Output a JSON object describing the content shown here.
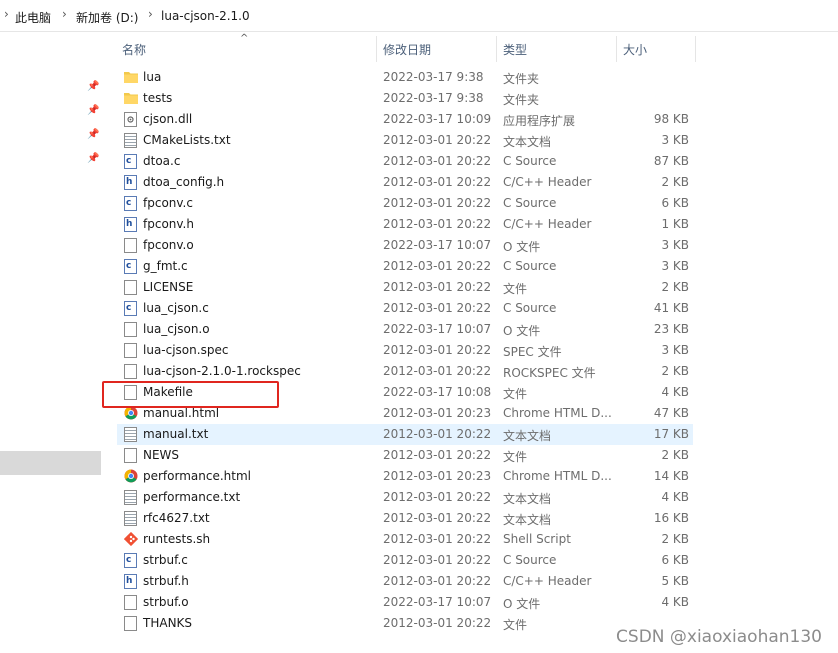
{
  "breadcrumb": [
    "此电脑",
    "新加卷 (D:)",
    "lua-cjson-2.1.0"
  ],
  "columns": {
    "name": "名称",
    "modified": "修改日期",
    "type": "类型",
    "size": "大小"
  },
  "files": [
    {
      "name": "lua",
      "date": "2022-03-17 9:38",
      "type": "文件夹",
      "size": "",
      "icon": "folder-icon"
    },
    {
      "name": "tests",
      "date": "2022-03-17 9:38",
      "type": "文件夹",
      "size": "",
      "icon": "folder-icon"
    },
    {
      "name": "cjson.dll",
      "date": "2022-03-17 10:09",
      "type": "应用程序扩展",
      "size": "98 KB",
      "icon": "dll-icon"
    },
    {
      "name": "CMakeLists.txt",
      "date": "2012-03-01 20:22",
      "type": "文本文档",
      "size": "3 KB",
      "icon": "text-file-icon"
    },
    {
      "name": "dtoa.c",
      "date": "2012-03-01 20:22",
      "type": "C Source",
      "size": "87 KB",
      "icon": "c-file-icon"
    },
    {
      "name": "dtoa_config.h",
      "date": "2012-03-01 20:22",
      "type": "C/C++ Header",
      "size": "2 KB",
      "icon": "h-file-icon"
    },
    {
      "name": "fpconv.c",
      "date": "2012-03-01 20:22",
      "type": "C Source",
      "size": "6 KB",
      "icon": "c-file-icon"
    },
    {
      "name": "fpconv.h",
      "date": "2012-03-01 20:22",
      "type": "C/C++ Header",
      "size": "1 KB",
      "icon": "h-file-icon"
    },
    {
      "name": "fpconv.o",
      "date": "2022-03-17 10:07",
      "type": "O 文件",
      "size": "3 KB",
      "icon": "blank-file-icon"
    },
    {
      "name": "g_fmt.c",
      "date": "2012-03-01 20:22",
      "type": "C Source",
      "size": "3 KB",
      "icon": "c-file-icon"
    },
    {
      "name": "LICENSE",
      "date": "2012-03-01 20:22",
      "type": "文件",
      "size": "2 KB",
      "icon": "blank-file-icon"
    },
    {
      "name": "lua_cjson.c",
      "date": "2012-03-01 20:22",
      "type": "C Source",
      "size": "41 KB",
      "icon": "c-file-icon"
    },
    {
      "name": "lua_cjson.o",
      "date": "2022-03-17 10:07",
      "type": "O 文件",
      "size": "23 KB",
      "icon": "blank-file-icon"
    },
    {
      "name": "lua-cjson.spec",
      "date": "2012-03-01 20:22",
      "type": "SPEC 文件",
      "size": "3 KB",
      "icon": "blank-file-icon"
    },
    {
      "name": "lua-cjson-2.1.0-1.rockspec",
      "date": "2012-03-01 20:22",
      "type": "ROCKSPEC 文件",
      "size": "2 KB",
      "icon": "blank-file-icon"
    },
    {
      "name": "Makefile",
      "date": "2022-03-17 10:08",
      "type": "文件",
      "size": "4 KB",
      "icon": "blank-file-icon"
    },
    {
      "name": "manual.html",
      "date": "2012-03-01 20:23",
      "type": "Chrome HTML D...",
      "size": "47 KB",
      "icon": "chrome-icon"
    },
    {
      "name": "manual.txt",
      "date": "2012-03-01 20:22",
      "type": "文本文档",
      "size": "17 KB",
      "icon": "text-file-icon",
      "selected": true
    },
    {
      "name": "NEWS",
      "date": "2012-03-01 20:22",
      "type": "文件",
      "size": "2 KB",
      "icon": "blank-file-icon"
    },
    {
      "name": "performance.html",
      "date": "2012-03-01 20:23",
      "type": "Chrome HTML D...",
      "size": "14 KB",
      "icon": "chrome-icon"
    },
    {
      "name": "performance.txt",
      "date": "2012-03-01 20:22",
      "type": "文本文档",
      "size": "4 KB",
      "icon": "text-file-icon"
    },
    {
      "name": "rfc4627.txt",
      "date": "2012-03-01 20:22",
      "type": "文本文档",
      "size": "16 KB",
      "icon": "text-file-icon"
    },
    {
      "name": "runtests.sh",
      "date": "2012-03-01 20:22",
      "type": "Shell Script",
      "size": "2 KB",
      "icon": "git-shell-icon"
    },
    {
      "name": "strbuf.c",
      "date": "2012-03-01 20:22",
      "type": "C Source",
      "size": "6 KB",
      "icon": "c-file-icon"
    },
    {
      "name": "strbuf.h",
      "date": "2012-03-01 20:22",
      "type": "C/C++ Header",
      "size": "5 KB",
      "icon": "h-file-icon"
    },
    {
      "name": "strbuf.o",
      "date": "2022-03-17 10:07",
      "type": "O 文件",
      "size": "4 KB",
      "icon": "blank-file-icon"
    },
    {
      "name": "THANKS",
      "date": "2012-03-01 20:22",
      "type": "文件",
      "size": "",
      "icon": "blank-file-icon"
    }
  ],
  "highlighted_file": "Makefile",
  "watermark": "CSDN @xiaoxiaohan130",
  "colors": {
    "selected_row": "#e5f3ff",
    "highlight_box": "#e0261f",
    "header_text": "#4c607a"
  }
}
